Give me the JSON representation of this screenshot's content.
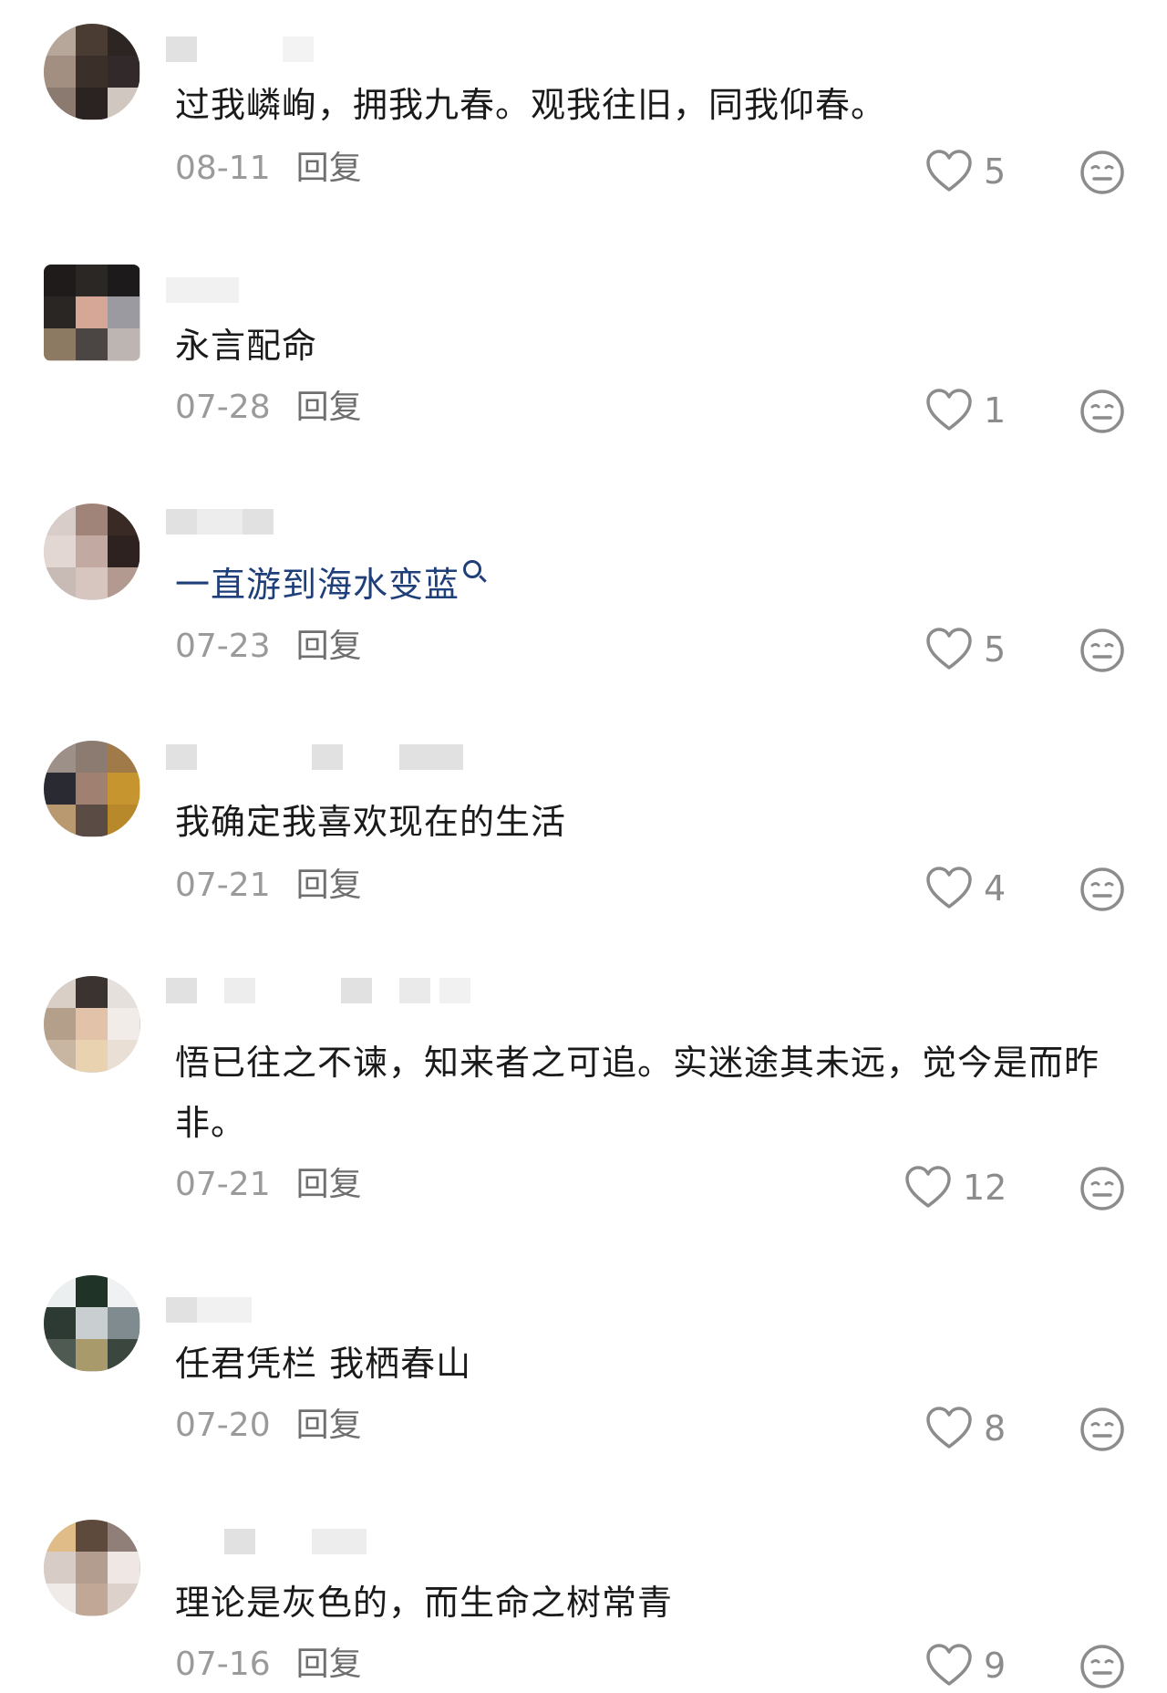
{
  "comments": [
    {
      "text": "过我嶙峋，拥我九春。观我往旧，同我仰春。",
      "date": "08-11",
      "reply": "回复",
      "likes": "5"
    },
    {
      "text": "永言配命",
      "date": "07-28",
      "reply": "回复",
      "likes": "1"
    },
    {
      "text": "一直游到海水变蓝",
      "date": "07-23",
      "reply": "回复",
      "likes": "5"
    },
    {
      "text": "我确定我喜欢现在的生活",
      "date": "07-21",
      "reply": "回复",
      "likes": "4"
    },
    {
      "text": "悟已往之不谏，知来者之可追。实迷途其未远，觉今是而昨非。",
      "date": "07-21",
      "reply": "回复",
      "likes": "12"
    },
    {
      "text": "任君凭栏 我栖春山",
      "date": "07-20",
      "reply": "回复",
      "likes": "8"
    },
    {
      "text": "理论是灰色的，而生命之树常青",
      "date": "07-16",
      "reply": "回复",
      "likes": "9"
    }
  ],
  "icons": {
    "like": "heart-outline-icon",
    "react": "meh-face-icon"
  },
  "colors": {
    "link": "#1f3f7a",
    "meta": "#9a9a9a",
    "icon": "#8c8c8c"
  }
}
